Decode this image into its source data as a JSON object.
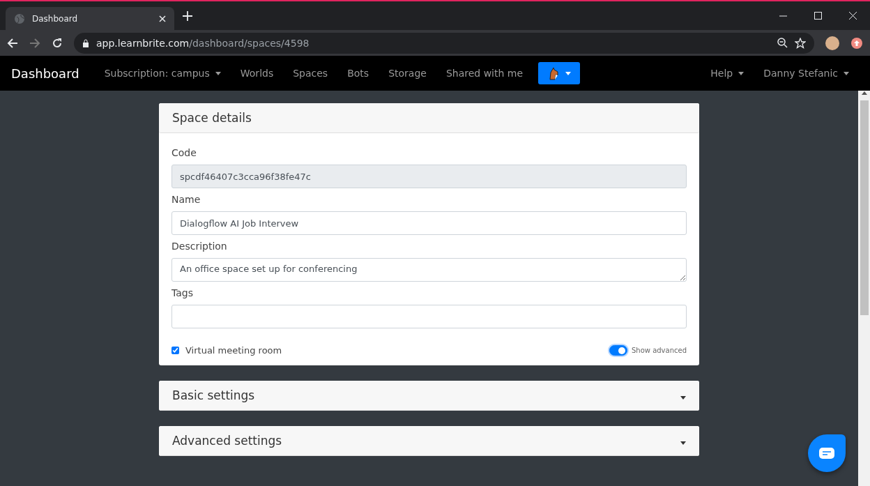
{
  "browser": {
    "tab_title": "Dashboard",
    "url_host": "app.learnbrite.com",
    "url_path": "/dashboard/spaces/4598"
  },
  "navbar": {
    "brand": "Dashboard",
    "items": [
      {
        "label": "Subscription: campus",
        "dropdown": true
      },
      {
        "label": "Worlds",
        "dropdown": false
      },
      {
        "label": "Spaces",
        "dropdown": false
      },
      {
        "label": "Bots",
        "dropdown": false
      },
      {
        "label": "Storage",
        "dropdown": false
      },
      {
        "label": "Shared with me",
        "dropdown": false
      }
    ],
    "right_items": [
      {
        "label": "Help",
        "dropdown": true
      },
      {
        "label": "Danny Stefanic",
        "dropdown": true
      }
    ]
  },
  "card": {
    "title": "Space details",
    "fields": [
      {
        "label": "Code",
        "kind": "input",
        "value": "spcdf46407c3cca96f38fe47c",
        "disabled": true
      },
      {
        "label": "Name",
        "kind": "input",
        "value": "Dialogflow AI Job Intervew",
        "disabled": false
      },
      {
        "label": "Description",
        "kind": "textarea",
        "value": "An office space set up for conferencing",
        "disabled": false
      },
      {
        "label": "Tags",
        "kind": "input",
        "disabled": false
      }
    ],
    "virtual_meeting": {
      "label": "Virtual meeting room",
      "checked": true
    },
    "show_advanced": {
      "label": "Show advanced",
      "on": true
    }
  },
  "sections": [
    {
      "title": "Basic settings"
    },
    {
      "title": "Advanced settings"
    }
  ]
}
